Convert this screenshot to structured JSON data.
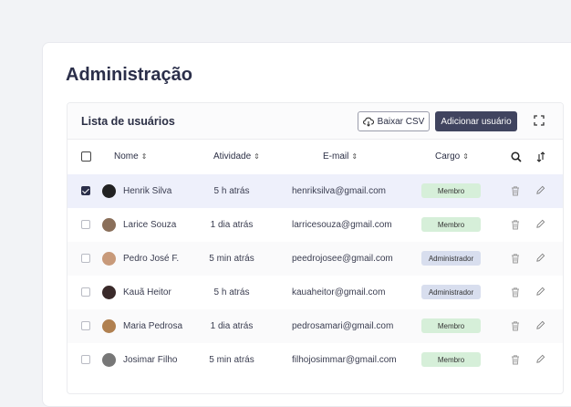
{
  "page": {
    "title": "Administração"
  },
  "panel": {
    "title": "Lista de usuários",
    "csv_label": "Baixar CSV",
    "add_label": "Adicionar usuário"
  },
  "columns": {
    "name": "Nome",
    "activity": "Atividade",
    "email": "E-mail",
    "role": "Cargo"
  },
  "colors": {
    "accent": "#40445f",
    "member": "#d6efd9",
    "admin": "#d8deee",
    "selected_row": "#eef0fb"
  },
  "rows": [
    {
      "name": "Henrik Silva",
      "activity": "5 h atrás",
      "email": "henriksilva@gmail.com",
      "role": "Membro",
      "checked": true
    },
    {
      "name": "Larice Souza",
      "activity": "1 dia atrás",
      "email": "larricesouza@gmail.com",
      "role": "Membro",
      "checked": false
    },
    {
      "name": "Pedro José F.",
      "activity": "5 min atrás",
      "email": "peedrojosee@gmail.com",
      "role": "Administrador",
      "checked": false
    },
    {
      "name": "Kauã Heitor",
      "activity": "5 h atrás",
      "email": "kauaheitor@gmail.com",
      "role": "Administrador",
      "checked": false
    },
    {
      "name": "Maria Pedrosa",
      "activity": "1 dia atrás",
      "email": "pedrosamari@gmail.com",
      "role": "Membro",
      "checked": false
    },
    {
      "name": "Josimar Filho",
      "activity": "5 min atrás",
      "email": "filhojosimmar@gmail.com",
      "role": "Membro",
      "checked": false
    }
  ]
}
